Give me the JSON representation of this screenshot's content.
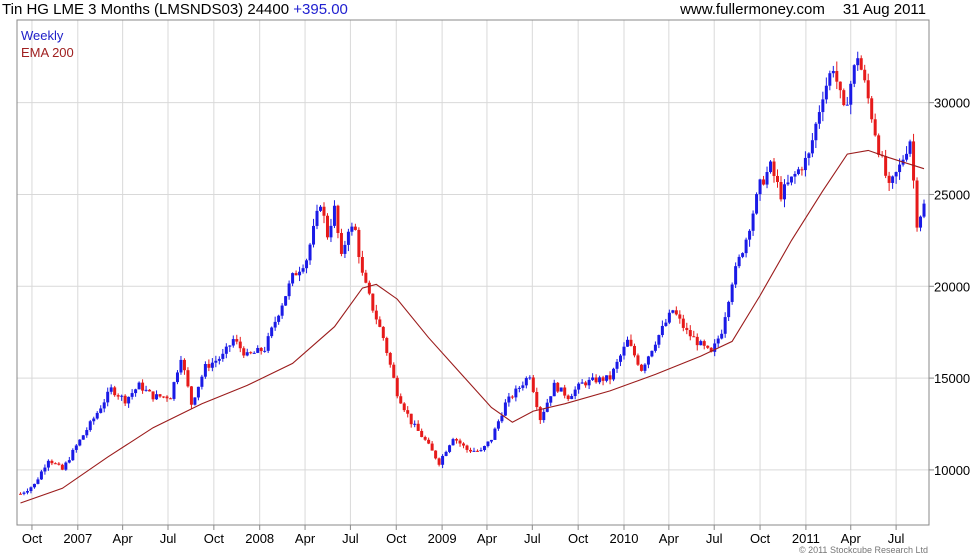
{
  "header": {
    "instrument": "Tin HG LME 3 Months (LMSNDS03)",
    "last": "24400",
    "change": "+395.00",
    "source": "www.fullermoney.com",
    "date": "31 Aug 2011"
  },
  "legend": {
    "weekly": "Weekly",
    "ema": "EMA 200"
  },
  "copyright": "© 2011 Stockcube Research Ltd",
  "colors": {
    "up": "#1a1ae6",
    "down": "#e61a1a",
    "ema": "#9b1c1c",
    "grid": "#d9d9d9",
    "axis": "#888888"
  },
  "chart_data": {
    "type": "candlestick",
    "series": [
      {
        "name": "Weekly",
        "style": "candlestick"
      },
      {
        "name": "EMA 200",
        "style": "line"
      }
    ],
    "x_ticks": [
      "Oct",
      "2007",
      "Apr",
      "Jul",
      "Oct",
      "2008",
      "Apr",
      "Jul",
      "Oct",
      "2009",
      "Apr",
      "Jul",
      "Oct",
      "2010",
      "Apr",
      "Jul",
      "Oct",
      "2011",
      "Apr",
      "Jul"
    ],
    "y_ticks": [
      10000,
      15000,
      20000,
      25000,
      30000
    ],
    "ylim": [
      7000,
      34500
    ],
    "x_range": [
      "2006-09-01",
      "2011-09-05"
    ],
    "grid": true,
    "y_axis_position": "right",
    "legend_position": "top-left",
    "price_keypoints": [
      [
        "2006-09-08",
        8700
      ],
      [
        "2006-10-06",
        9200
      ],
      [
        "2006-11-03",
        10600
      ],
      [
        "2006-12-01",
        10000
      ],
      [
        "2006-12-29",
        11300
      ],
      [
        "2007-02-02",
        12800
      ],
      [
        "2007-03-09",
        14400
      ],
      [
        "2007-04-06",
        13800
      ],
      [
        "2007-05-04",
        14600
      ],
      [
        "2007-06-01",
        14000
      ],
      [
        "2007-07-06",
        14000
      ],
      [
        "2007-07-27",
        16200
      ],
      [
        "2007-08-17",
        13600
      ],
      [
        "2007-09-14",
        15600
      ],
      [
        "2007-10-19",
        16200
      ],
      [
        "2007-11-09",
        17100
      ],
      [
        "2007-12-07",
        16200
      ],
      [
        "2008-01-11",
        16600
      ],
      [
        "2008-02-08",
        18600
      ],
      [
        "2008-03-07",
        20500
      ],
      [
        "2008-04-04",
        21500
      ],
      [
        "2008-05-02",
        24600
      ],
      [
        "2008-05-16",
        22800
      ],
      [
        "2008-05-30",
        24200
      ],
      [
        "2008-06-13",
        21500
      ],
      [
        "2008-06-27",
        23200
      ],
      [
        "2008-07-11",
        23000
      ],
      [
        "2008-07-25",
        20600
      ],
      [
        "2008-08-15",
        18800
      ],
      [
        "2008-09-05",
        17200
      ],
      [
        "2008-10-03",
        14200
      ],
      [
        "2008-10-31",
        12600
      ],
      [
        "2008-11-28",
        11600
      ],
      [
        "2008-12-26",
        10400
      ],
      [
        "2009-01-23",
        11800
      ],
      [
        "2009-02-20",
        11100
      ],
      [
        "2009-03-20",
        11000
      ],
      [
        "2009-04-10",
        11700
      ],
      [
        "2009-05-08",
        13600
      ],
      [
        "2009-06-05",
        14500
      ],
      [
        "2009-06-26",
        15200
      ],
      [
        "2009-07-17",
        12800
      ],
      [
        "2009-08-14",
        14600
      ],
      [
        "2009-09-11",
        14000
      ],
      [
        "2009-10-09",
        14700
      ],
      [
        "2009-11-06",
        14900
      ],
      [
        "2009-12-04",
        15000
      ],
      [
        "2010-01-08",
        17000
      ],
      [
        "2010-02-05",
        15500
      ],
      [
        "2010-03-05",
        17000
      ],
      [
        "2010-04-09",
        18700
      ],
      [
        "2010-05-07",
        17500
      ],
      [
        "2010-06-04",
        16800
      ],
      [
        "2010-06-25",
        16300
      ],
      [
        "2010-07-16",
        17600
      ],
      [
        "2010-08-06",
        20300
      ],
      [
        "2010-09-03",
        22600
      ],
      [
        "2010-10-01",
        25500
      ],
      [
        "2010-10-22",
        26500
      ],
      [
        "2010-11-12",
        25000
      ],
      [
        "2010-12-03",
        25800
      ],
      [
        "2011-01-07",
        27100
      ],
      [
        "2011-02-04",
        30500
      ],
      [
        "2011-02-25",
        32000
      ],
      [
        "2011-03-18",
        29500
      ],
      [
        "2011-04-15",
        32600
      ],
      [
        "2011-05-06",
        30200
      ],
      [
        "2011-05-27",
        27500
      ],
      [
        "2011-06-17",
        25300
      ],
      [
        "2011-07-08",
        26500
      ],
      [
        "2011-07-29",
        28000
      ],
      [
        "2011-08-12",
        23500
      ],
      [
        "2011-08-26",
        24400
      ]
    ],
    "ema_200_keypoints": [
      [
        "2006-09-08",
        8200
      ],
      [
        "2006-12-01",
        9000
      ],
      [
        "2007-03-02",
        10700
      ],
      [
        "2007-06-01",
        12300
      ],
      [
        "2007-09-07",
        13600
      ],
      [
        "2007-12-07",
        14600
      ],
      [
        "2008-03-07",
        15800
      ],
      [
        "2008-05-30",
        17800
      ],
      [
        "2008-07-25",
        19900
      ],
      [
        "2008-08-22",
        20100
      ],
      [
        "2008-10-03",
        19300
      ],
      [
        "2008-12-05",
        17200
      ],
      [
        "2009-02-06",
        15300
      ],
      [
        "2009-04-10",
        13400
      ],
      [
        "2009-05-22",
        12600
      ],
      [
        "2009-07-03",
        13200
      ],
      [
        "2009-09-04",
        13600
      ],
      [
        "2009-12-04",
        14300
      ],
      [
        "2010-03-05",
        15200
      ],
      [
        "2010-06-04",
        16200
      ],
      [
        "2010-08-06",
        17000
      ],
      [
        "2010-10-01",
        19500
      ],
      [
        "2010-12-03",
        22500
      ],
      [
        "2011-02-04",
        25200
      ],
      [
        "2011-03-25",
        27200
      ],
      [
        "2011-05-06",
        27400
      ],
      [
        "2011-06-17",
        27000
      ],
      [
        "2011-08-26",
        26400
      ]
    ]
  }
}
